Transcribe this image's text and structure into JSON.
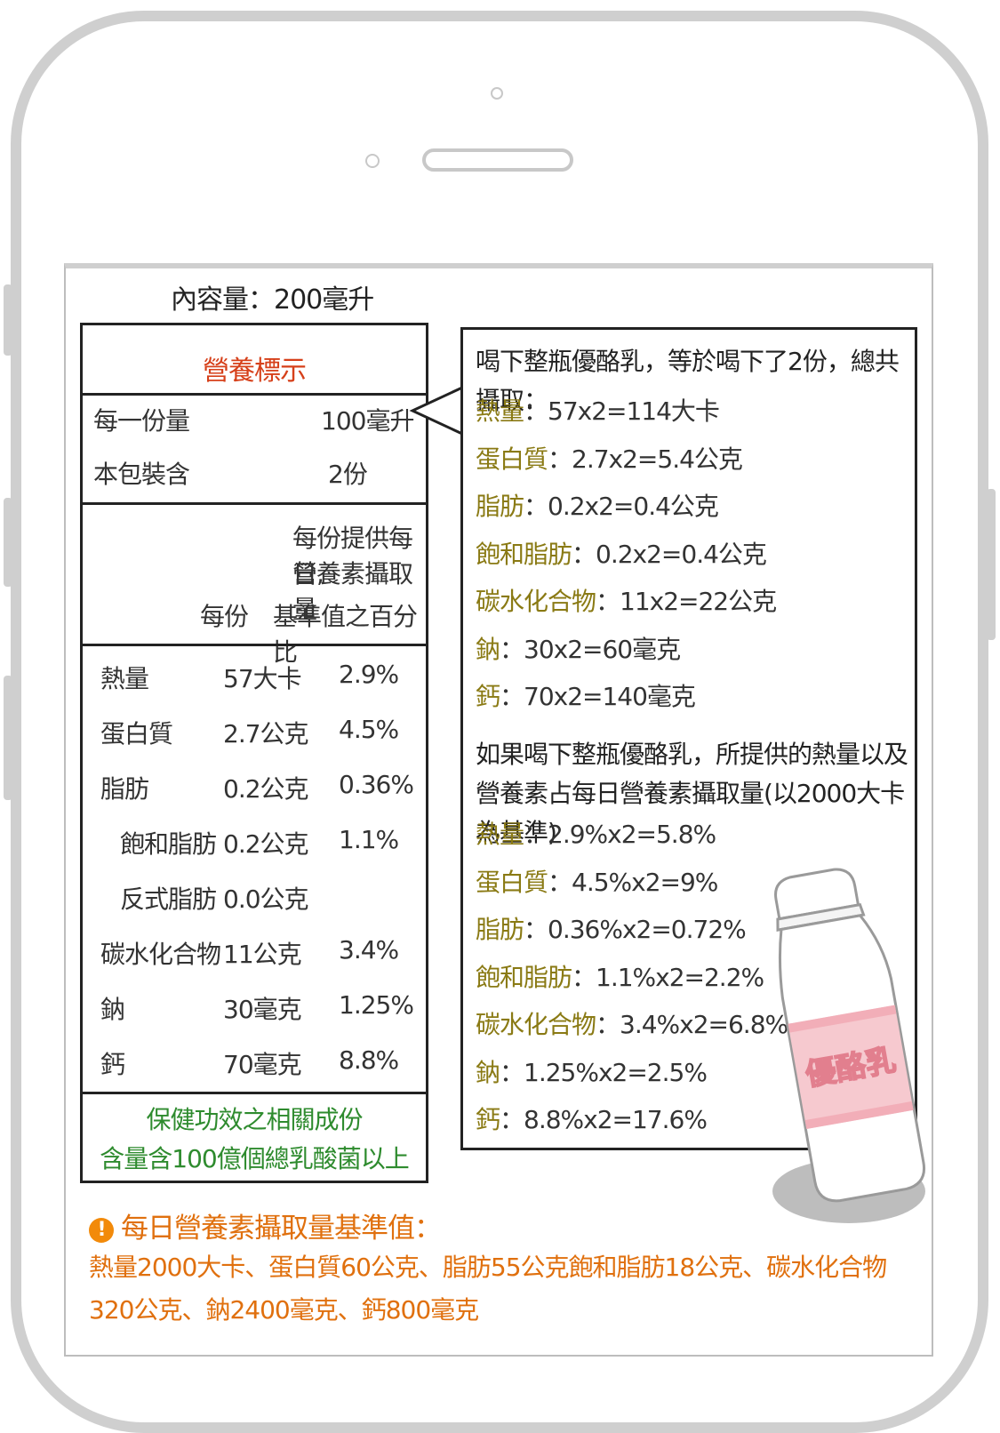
{
  "content_amount": "內容量：200毫升",
  "label": {
    "title": "營養標示",
    "serving_size_label": "每一份量",
    "serving_size_value": "100毫升",
    "servings_label": "本包裝含",
    "servings_value": "2份",
    "header_daily_line1": "每份提供每日",
    "header_daily_line2": "營養素攝取量",
    "header_per_serving": "每份",
    "header_percent": "基準值之百分比",
    "rows": [
      {
        "name": "熱量",
        "amount": "57大卡",
        "percent": "2.9%"
      },
      {
        "name": "蛋白質",
        "amount": "2.7公克",
        "percent": "4.5%"
      },
      {
        "name": "脂肪",
        "amount": "0.2公克",
        "percent": "0.36%"
      },
      {
        "name": "飽和脂肪",
        "amount": "0.2公克",
        "percent": "1.1%"
      },
      {
        "name": "反式脂肪",
        "amount": "0.0公克",
        "percent": ""
      },
      {
        "name": "碳水化合物",
        "amount": "11公克",
        "percent": "3.4%"
      },
      {
        "name": "鈉",
        "amount": "30毫克",
        "percent": "1.25%"
      },
      {
        "name": "鈣",
        "amount": "70毫克",
        "percent": "8.8%"
      }
    ],
    "health_line1": "保健功效之相關成份",
    "health_line2": "含量含100億個總乳酸菌以上"
  },
  "bubble": {
    "heading1": "喝下整瓶優酪乳，等於喝下了2份，總共攝取：",
    "totals": [
      {
        "k": "熱量",
        "v": "：57x2=114大卡"
      },
      {
        "k": "蛋白質",
        "v": "：2.7x2=5.4公克"
      },
      {
        "k": "脂肪",
        "v": "：0.2x2=0.4公克"
      },
      {
        "k": "飽和脂肪",
        "v": "：0.2x2=0.4公克"
      },
      {
        "k": "碳水化合物",
        "v": "：11x2=22公克"
      },
      {
        "k": "鈉",
        "v": "：30x2=60毫克"
      },
      {
        "k": "鈣",
        "v": "：70x2=140毫克"
      }
    ],
    "heading2": "如果喝下整瓶優酪乳，所提供的熱量以及營養素占每日營養素攝取量(以2000大卡為基準)",
    "percents": [
      {
        "k": "熱量",
        "v": "：2.9%x2=5.8%"
      },
      {
        "k": "蛋白質",
        "v": "：4.5%x2=9%"
      },
      {
        "k": "脂肪",
        "v": "：0.36%x2=0.72%"
      },
      {
        "k": "飽和脂肪",
        "v": "：1.1%x2=2.2%"
      },
      {
        "k": "碳水化合物",
        "v": "：3.4%x2=6.8%"
      },
      {
        "k": "鈉",
        "v": "：1.25%x2=2.5%"
      },
      {
        "k": "鈣",
        "v": "：8.8%x2=17.6%"
      }
    ]
  },
  "bottle_label": "優酪乳",
  "notice": {
    "icon": "!",
    "title": "每日營養素攝取量基準值：",
    "text": "熱量2000大卡、蛋白質60公克、脂肪55公克飽和脂肪18公克、碳水化合物320公克、鈉2400毫克、鈣800毫克"
  },
  "colors": {
    "title_red": "#d6401a",
    "nutrient_olive": "#8a7a14",
    "health_green": "#2e8b2e",
    "notice_orange": "#e0700e"
  }
}
